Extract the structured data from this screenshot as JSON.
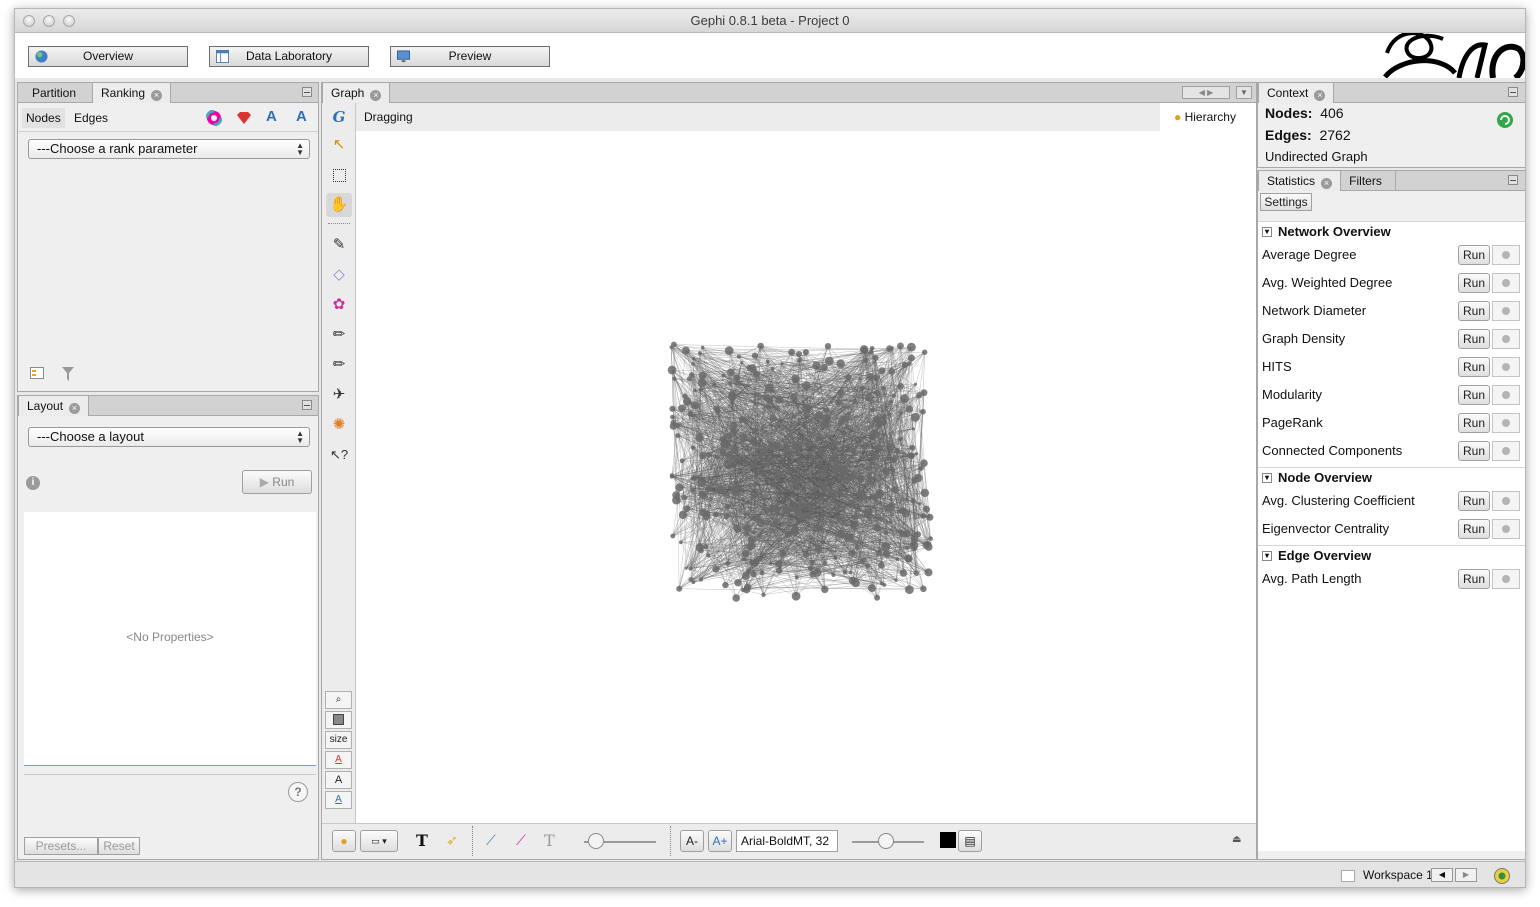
{
  "window": {
    "title": "Gephi 0.8.1 beta - Project 0"
  },
  "toolbar": {
    "overview": "Overview",
    "data_laboratory": "Data Laboratory",
    "preview": "Preview"
  },
  "ranking": {
    "tabs": [
      "Partition",
      "Ranking"
    ],
    "subtabs": [
      "Nodes",
      "Edges"
    ],
    "combo": "---Choose a rank parameter"
  },
  "layout": {
    "tab": "Layout",
    "combo": "---Choose a layout",
    "run": "Run",
    "no_props": "<No Properties>",
    "presets": "Presets...",
    "reset": "Reset"
  },
  "graph": {
    "tab": "Graph",
    "mode": "Dragging",
    "hierarchy": "Hierarchy",
    "size_label": "size",
    "font": "Arial-BoldMT, 32",
    "font_buttons": [
      "A",
      "A"
    ]
  },
  "context": {
    "tab": "Context",
    "nodes_label": "Nodes:",
    "nodes_value": "406",
    "edges_label": "Edges:",
    "edges_value": "2762",
    "graph_type": "Undirected Graph"
  },
  "statistics": {
    "tabs": [
      "Statistics",
      "Filters"
    ],
    "settings": "Settings",
    "run_label": "Run",
    "sections": [
      {
        "title": "Network Overview",
        "items": [
          "Average Degree",
          "Avg. Weighted Degree",
          "Network Diameter",
          "Graph Density",
          "HITS",
          "Modularity",
          "PageRank",
          "Connected Components"
        ]
      },
      {
        "title": "Node Overview",
        "items": [
          "Avg. Clustering Coefficient",
          "Eigenvector Centrality"
        ]
      },
      {
        "title": "Edge Overview",
        "items": [
          "Avg. Path Length"
        ]
      }
    ]
  },
  "statusbar": {
    "workspace": "Workspace 1"
  },
  "colors": {
    "accent_blue": "#2f6fb8",
    "node_gray": "#6a6a6a",
    "panel_bg": "#efefef"
  }
}
